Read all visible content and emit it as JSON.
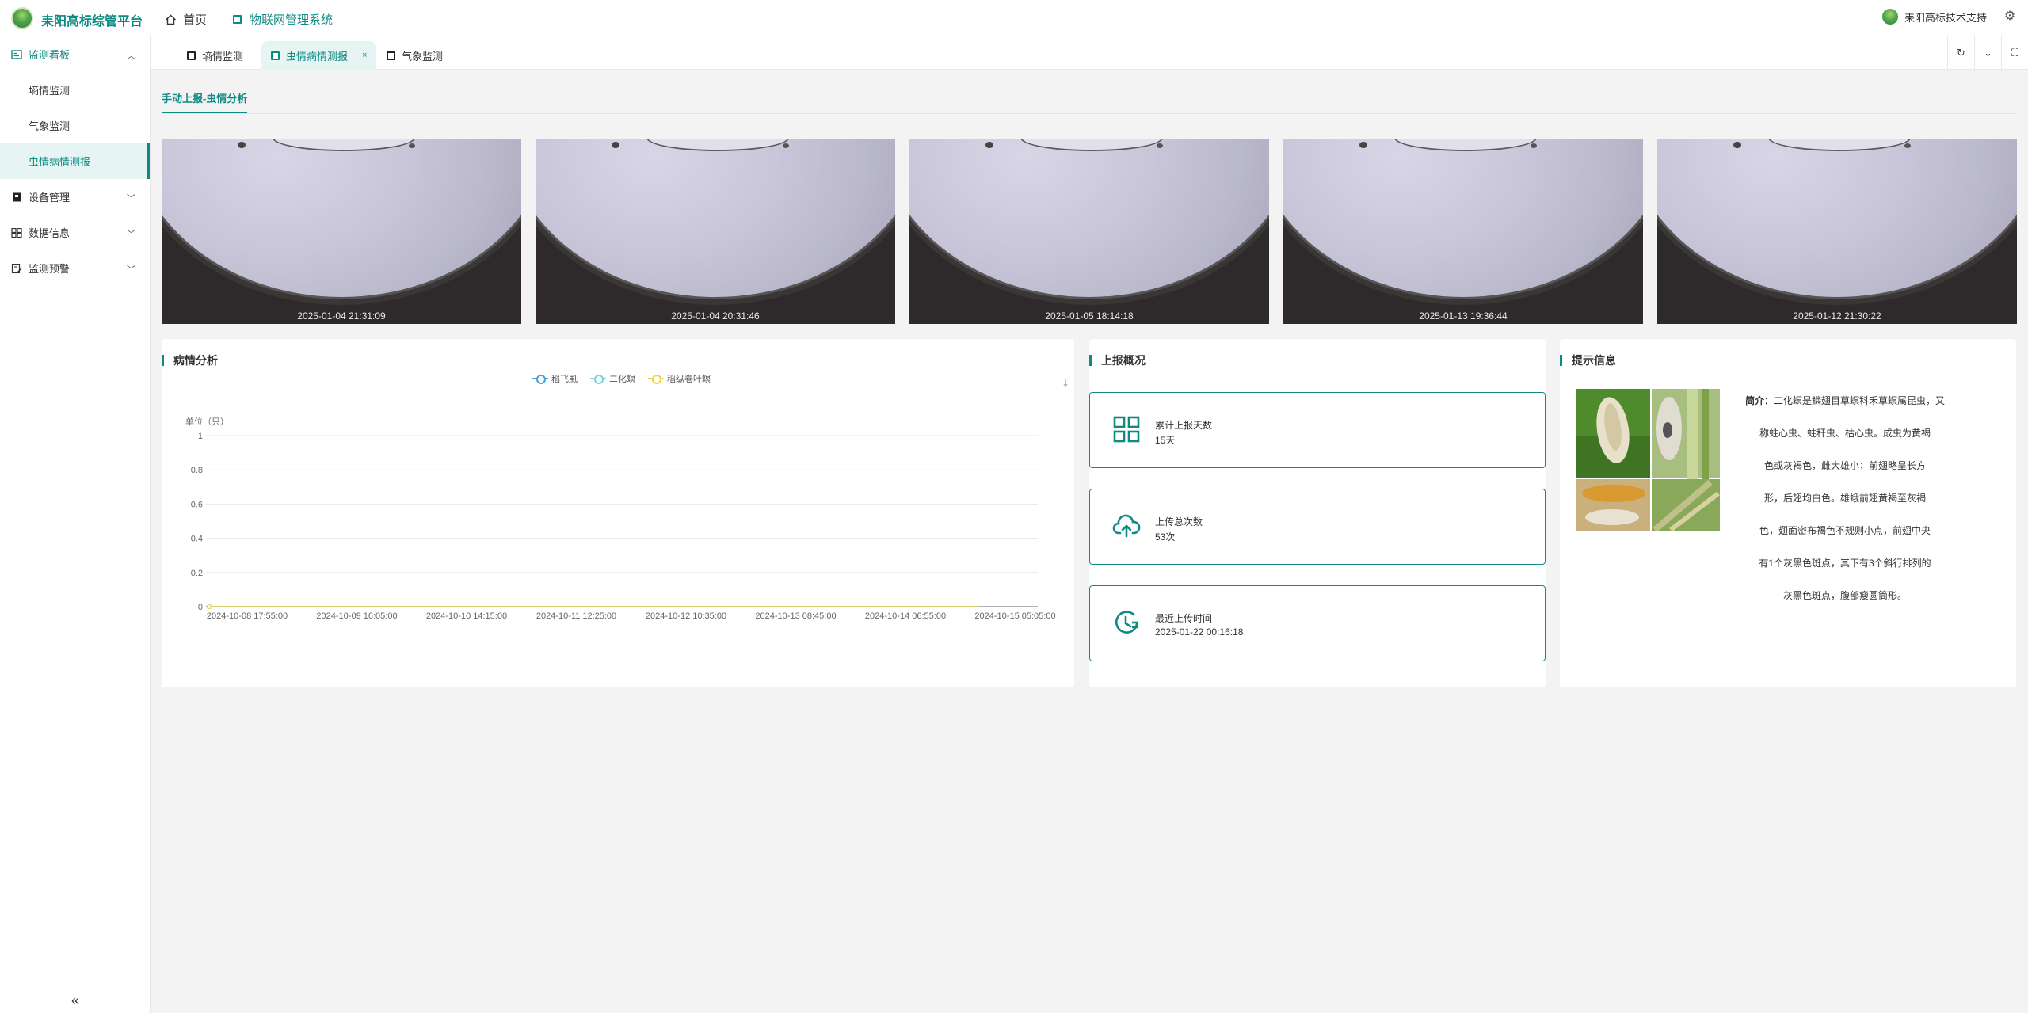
{
  "header": {
    "brand": "耒阳高标综管平台",
    "nav_home": "首页",
    "nav_iot": "物联网管理系统",
    "user_name": "耒阳高标技术支持"
  },
  "sidebar": {
    "groups": [
      {
        "label": "监测看板",
        "expanded": true,
        "icon": "dashboard-icon",
        "items": [
          {
            "label": "墒情监测",
            "active": false
          },
          {
            "label": "气象监测",
            "active": false
          },
          {
            "label": "虫情病情测报",
            "active": true
          }
        ]
      },
      {
        "label": "设备管理",
        "expanded": false,
        "icon": "device-icon"
      },
      {
        "label": "数据信息",
        "expanded": false,
        "icon": "data-icon"
      },
      {
        "label": "监测预警",
        "expanded": false,
        "icon": "warning-icon"
      }
    ],
    "collapse_glyph": "«"
  },
  "tabs": [
    {
      "label": "墒情监测",
      "active": false
    },
    {
      "label": "虫情病情测报",
      "active": true,
      "closable": true
    },
    {
      "label": "气象监测",
      "active": false
    }
  ],
  "page_subtab": "手动上报-虫情分析",
  "images": [
    {
      "timestamp": "2025-01-04 21:31:09"
    },
    {
      "timestamp": "2025-01-04 20:31:46"
    },
    {
      "timestamp": "2025-01-05 18:14:18"
    },
    {
      "timestamp": "2025-01-13 19:36:44"
    },
    {
      "timestamp": "2025-01-12 21:30:22"
    }
  ],
  "analysis": {
    "title": "病情分析",
    "legend": [
      {
        "name": "稻飞虱",
        "color": "#4a9fd6"
      },
      {
        "name": "二化螟",
        "color": "#7fd1dc"
      },
      {
        "name": "稻纵卷叶螟",
        "color": "#f2d24b"
      }
    ],
    "chart_data": {
      "type": "line",
      "ylabel": "单位（只）",
      "ylim": [
        0,
        1
      ],
      "yticks": [
        "1",
        "0.8",
        "0.6",
        "0.4",
        "0.2",
        "0"
      ],
      "x": [
        "2024-10-08 17:55:00",
        "2024-10-09 16:05:00",
        "2024-10-10 14:15:00",
        "2024-10-11 12:25:00",
        "2024-10-12 10:35:00",
        "2024-10-13 08:45:00",
        "2024-10-14 06:55:00",
        "2024-10-15 05:05:00"
      ],
      "series": [
        {
          "name": "稻飞虱",
          "values": [
            0,
            0,
            0,
            0,
            0,
            0,
            0,
            0
          ]
        },
        {
          "name": "二化螟",
          "values": [
            0,
            0,
            0,
            0,
            0,
            0,
            0,
            0
          ]
        },
        {
          "name": "稻纵卷叶螟",
          "values": [
            0,
            0,
            0,
            0,
            0,
            0,
            0,
            0
          ]
        }
      ],
      "grid": true
    }
  },
  "overview": {
    "title": "上报概况",
    "stats": [
      {
        "label": "累计上报天数",
        "value": "15天",
        "icon": "grid-icon"
      },
      {
        "label": "上传总次数",
        "value": "53次",
        "icon": "cloud-upload-icon"
      },
      {
        "label": "最近上传时间",
        "value": "2025-01-22 00:16:18",
        "icon": "clock-icon"
      }
    ]
  },
  "tips": {
    "title": "提示信息",
    "intro_label": "简介：",
    "intro_lines": [
      "二化螟是鳞翅目草螟科禾草螟属昆虫，又",
      "称蛀心虫、蛀秆虫、枯心虫。成虫为黄褐",
      "色或灰褐色，雌大雄小；前翅略呈长方",
      "形，后翅均白色。雄蛾前翅黄褐至灰褐",
      "色，翅面密布褐色不规则小点，前翅中央",
      "有1个灰黑色斑点，其下有3个斜行排列的",
      "灰黑色斑点，腹部瘦圆筒形。"
    ]
  }
}
